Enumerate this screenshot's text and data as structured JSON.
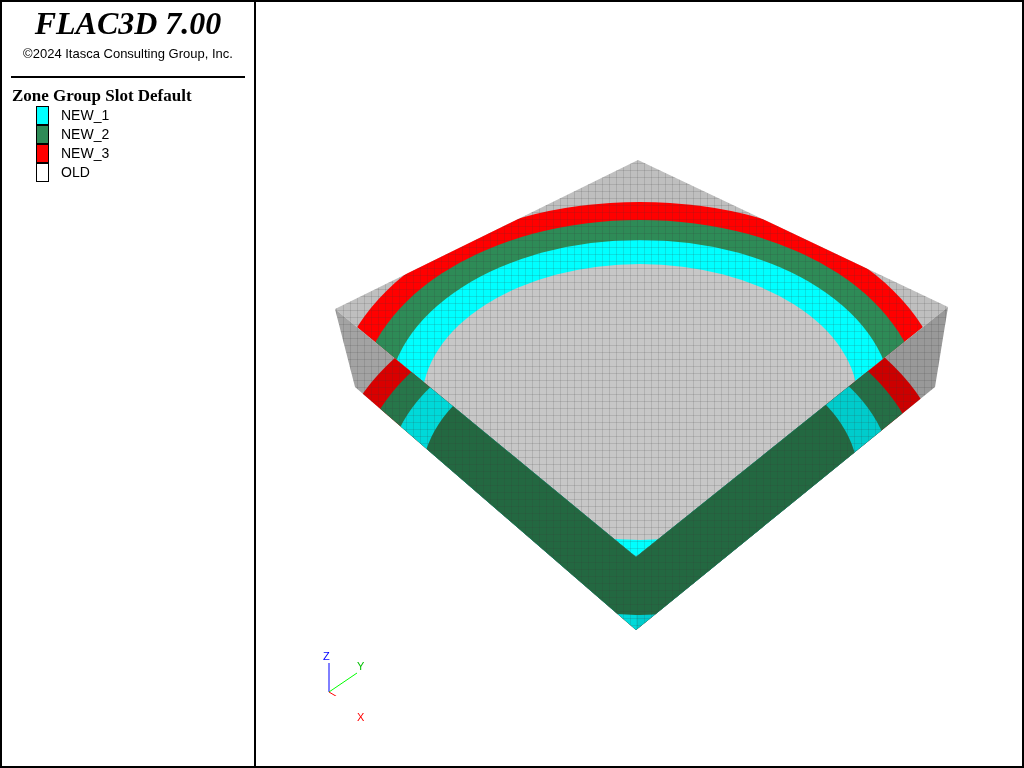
{
  "title": "FLAC3D 7.00",
  "copyright": "©2024 Itasca Consulting Group, Inc.",
  "legend": {
    "title": "Zone Group Slot Default",
    "items": [
      {
        "label": "NEW_1",
        "color": "#00ffff"
      },
      {
        "label": "NEW_2",
        "color": "#2e8b57"
      },
      {
        "label": "NEW_3",
        "color": "#ff0000"
      },
      {
        "label": "OLD",
        "color": "#ffffff"
      }
    ]
  },
  "axes": {
    "z": "Z",
    "y": "Y",
    "x": "X"
  }
}
